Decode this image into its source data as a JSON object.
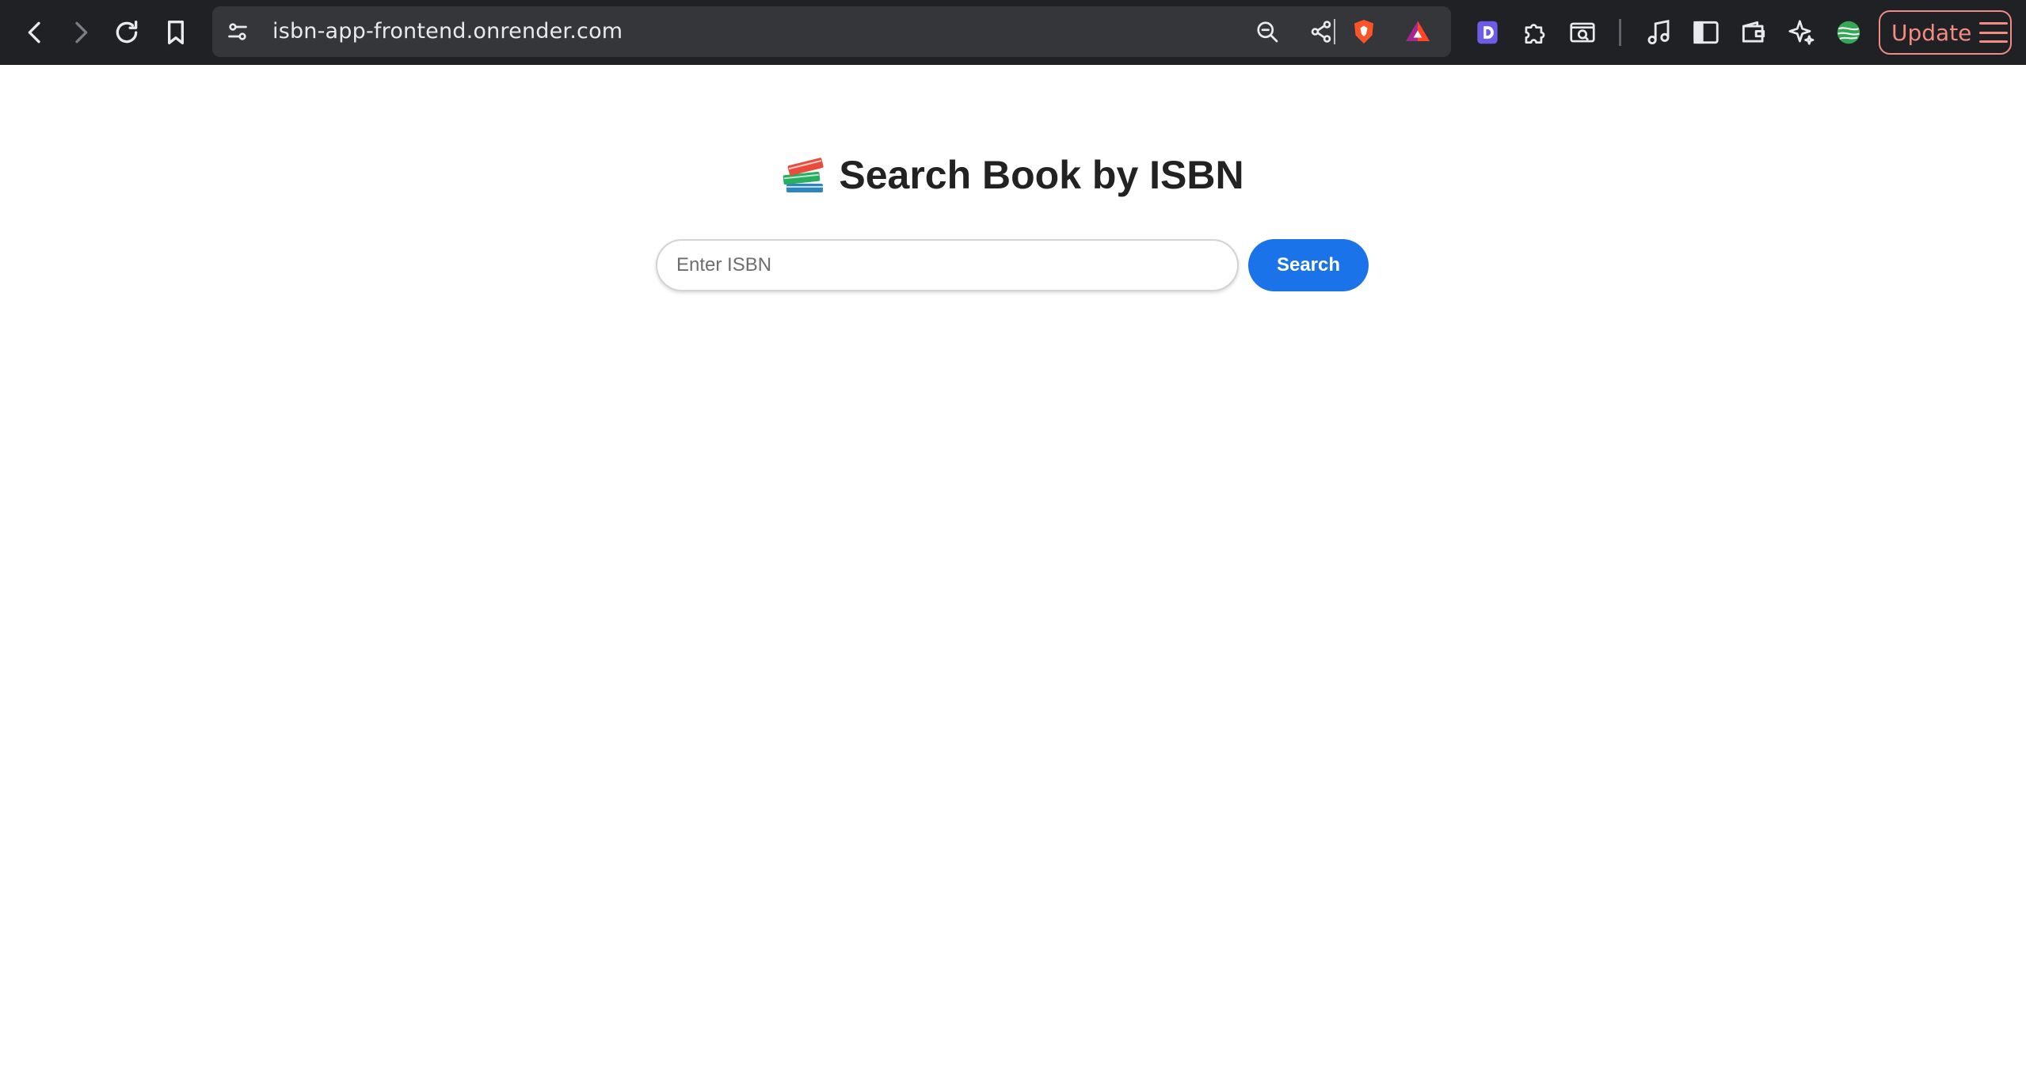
{
  "browser": {
    "url": "isbn-app-frontend.onrender.com",
    "update_label": "Update",
    "icons": {
      "back": "back-arrow-icon",
      "forward": "forward-arrow-icon",
      "reload": "reload-icon",
      "bookmark": "bookmark-icon",
      "site_settings": "site-settings-icon",
      "zoom": "zoom-out-icon",
      "share": "share-icon",
      "brave_shields": "brave-shields-icon",
      "brave_rewards": "brave-rewards-icon",
      "extension_d": "extension-d-icon",
      "extensions": "puzzle-icon",
      "screenshot": "screenshot-icon",
      "music": "music-icon",
      "sidebar": "sidebar-icon",
      "wallet": "wallet-icon",
      "leo": "leo-sparkle-icon",
      "vpn": "globe-icon",
      "menu": "hamburger-menu-icon"
    },
    "colors": {
      "toolbar_bg": "#202124",
      "urlbar_bg": "#35363a",
      "update_accent": "#f28b82"
    }
  },
  "page": {
    "title": "Search Book by ISBN",
    "title_icon": "books-icon",
    "search_input": {
      "placeholder": "Enter ISBN",
      "value": ""
    },
    "search_button_label": "Search",
    "colors": {
      "button_bg": "#1a73e8",
      "title_text": "#222222"
    }
  }
}
